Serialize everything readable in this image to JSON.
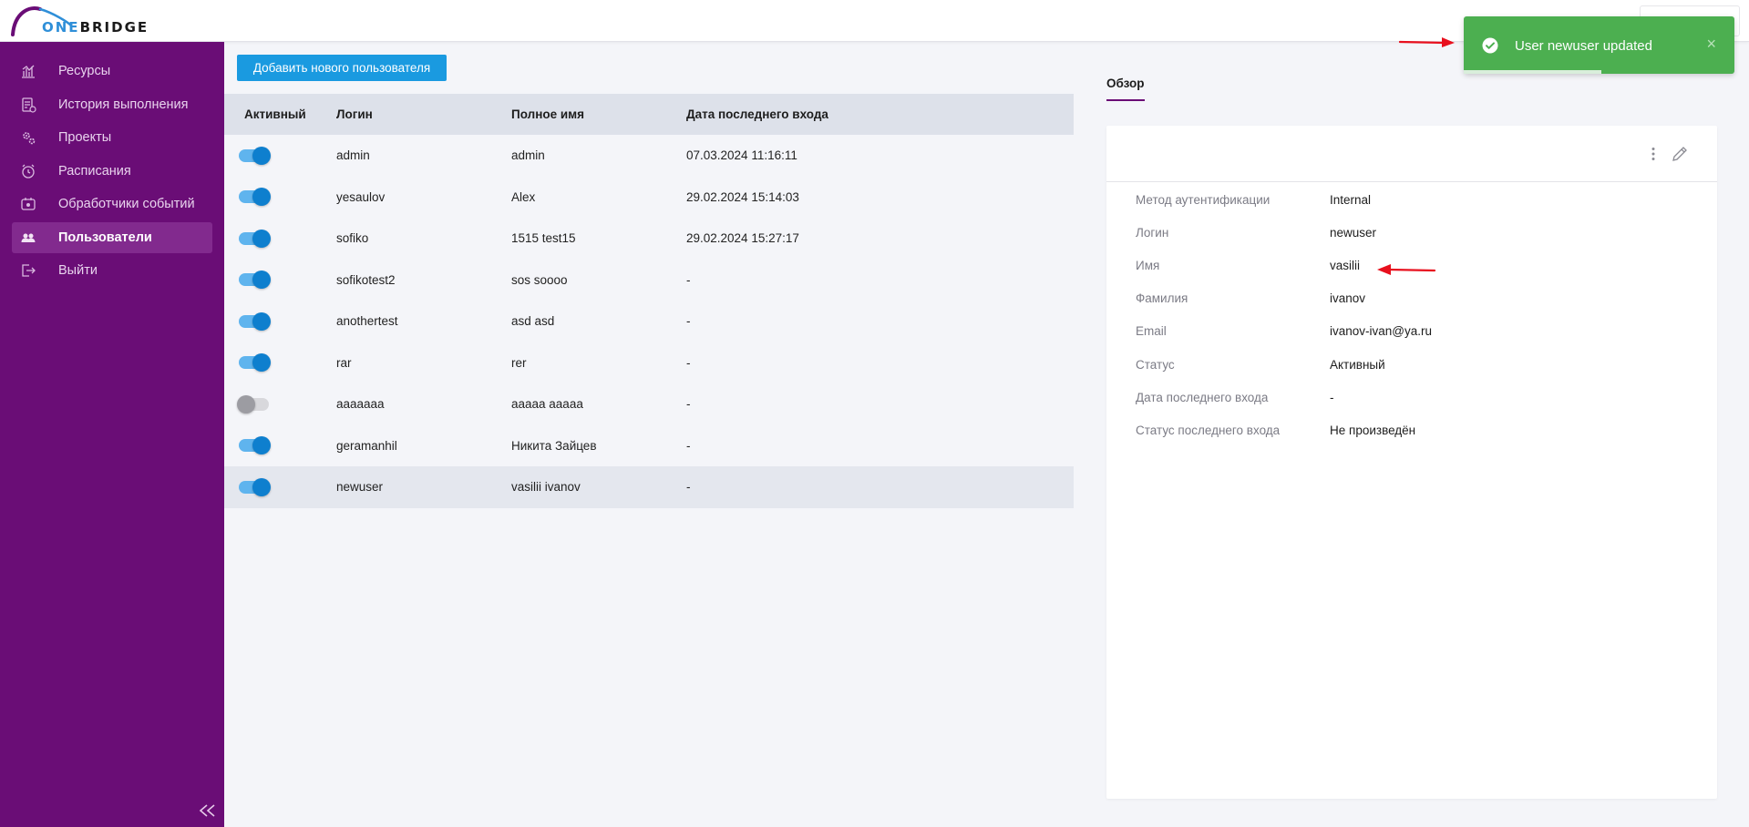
{
  "logo": {
    "prefix": "ONE",
    "suffix": "BRIDGE"
  },
  "sidebar": {
    "items": [
      {
        "label": "Ресурсы",
        "icon": "chart-icon",
        "active": false
      },
      {
        "label": "История выполнения",
        "icon": "history-doc-icon",
        "active": false
      },
      {
        "label": "Проекты",
        "icon": "gears-icon",
        "active": false
      },
      {
        "label": "Расписания",
        "icon": "alarm-clock-icon",
        "active": false
      },
      {
        "label": "Обработчики событий",
        "icon": "event-handler-icon",
        "active": false
      },
      {
        "label": "Пользователи",
        "icon": "users-icon",
        "active": true
      },
      {
        "label": "Выйти",
        "icon": "logout-icon",
        "active": false
      }
    ]
  },
  "main": {
    "add_button": "Добавить нового пользователя",
    "columns": [
      "Активный",
      "Логин",
      "Полное имя",
      "Дата последнего входа"
    ],
    "rows": [
      {
        "active": true,
        "login": "admin",
        "full_name": "admin",
        "last_login": "07.03.2024 11:16:11"
      },
      {
        "active": true,
        "login": "yesaulov",
        "full_name": "Alex",
        "last_login": "29.02.2024 15:14:03"
      },
      {
        "active": true,
        "login": "sofiko",
        "full_name": "1515 test15",
        "last_login": "29.02.2024 15:27:17"
      },
      {
        "active": true,
        "login": "sofikotest2",
        "full_name": "sos soooo",
        "last_login": "-"
      },
      {
        "active": true,
        "login": "anothertest",
        "full_name": "asd asd",
        "last_login": "-"
      },
      {
        "active": true,
        "login": "rar",
        "full_name": "rer",
        "last_login": "-"
      },
      {
        "active": false,
        "login": "aaaaaaa",
        "full_name": "aaaaa aaaaa",
        "last_login": "-"
      },
      {
        "active": true,
        "login": "geramanhil",
        "full_name": "Никита Зайцев",
        "last_login": "-"
      },
      {
        "active": true,
        "login": "newuser",
        "full_name": "vasilii ivanov",
        "last_login": "-",
        "selected": true
      }
    ]
  },
  "detail": {
    "tab": "Обзор",
    "fields": [
      {
        "label": "Метод аутентификации",
        "value": "Internal"
      },
      {
        "label": "Логин",
        "value": "newuser"
      },
      {
        "label": "Имя",
        "value": "vasilii"
      },
      {
        "label": "Фамилия",
        "value": "ivanov"
      },
      {
        "label": "Email",
        "value": "ivanov-ivan@ya.ru"
      },
      {
        "label": "Статус",
        "value": "Активный"
      },
      {
        "label": "Дата последнего входа",
        "value": "-"
      },
      {
        "label": "Статус последнего входа",
        "value": "Не произведён"
      }
    ]
  },
  "toast": {
    "message": "User newuser updated",
    "close": "×",
    "progress_fraction": 0.51
  },
  "colors": {
    "sidebar_bg": "#6a0d76",
    "sidebar_active": "#822a8e",
    "primary_button": "#1a9ae0",
    "toggle_on": "#0e7fce",
    "toast_bg": "#4caf50",
    "annotation_arrow": "#e8101e"
  }
}
